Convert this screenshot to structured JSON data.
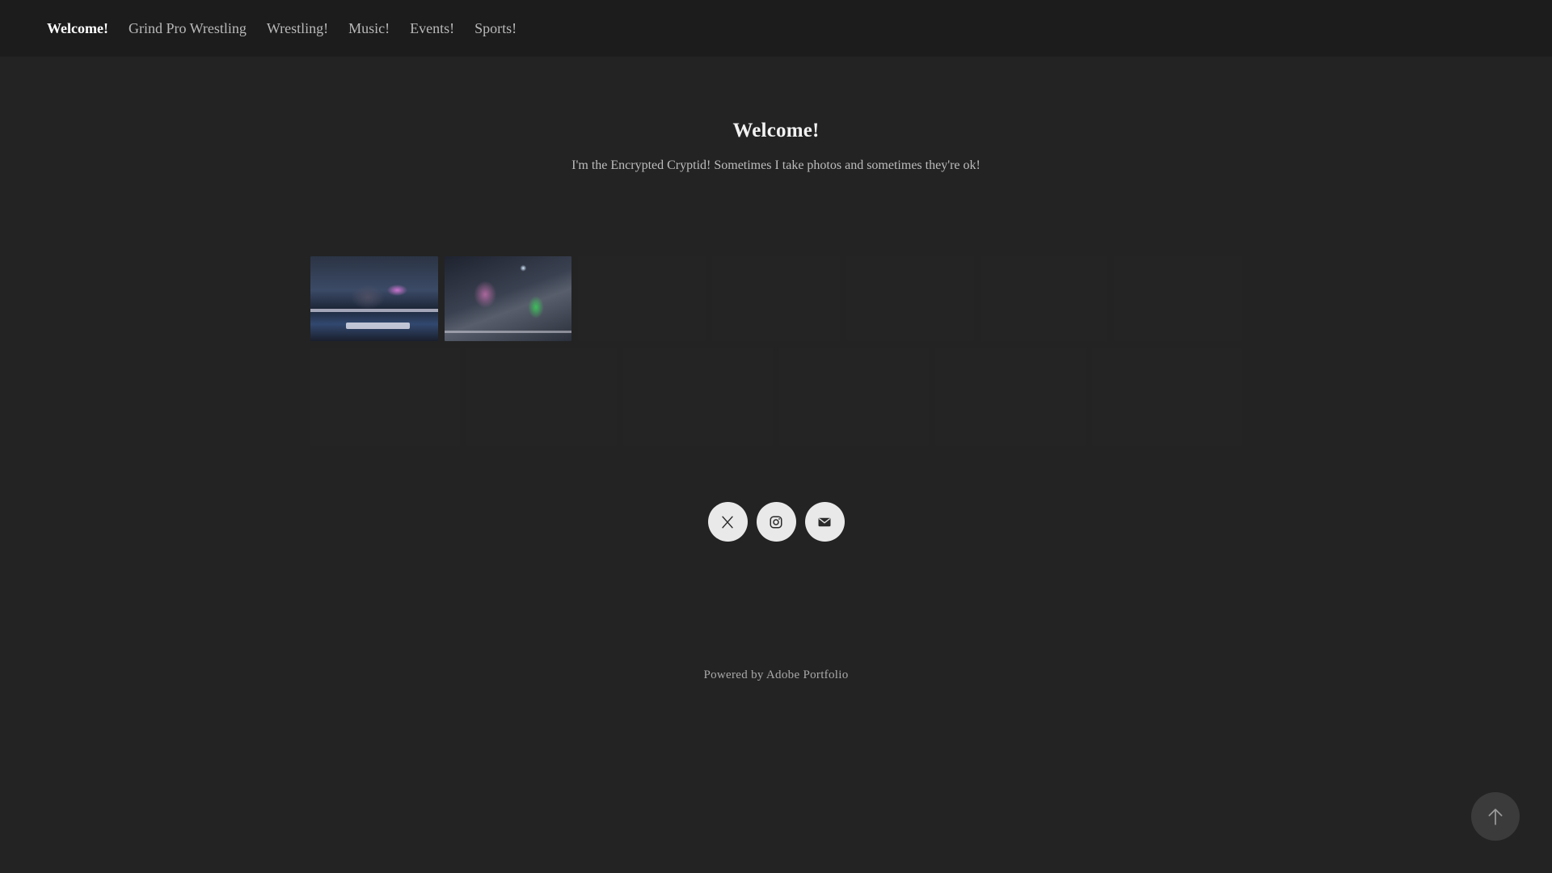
{
  "nav": {
    "items": [
      {
        "label": "Welcome!",
        "active": true
      },
      {
        "label": "Grind Pro Wrestling",
        "active": false
      },
      {
        "label": "Wrestling!",
        "active": false
      },
      {
        "label": "Music!",
        "active": false
      },
      {
        "label": "Events!",
        "active": false
      },
      {
        "label": "Sports!",
        "active": false
      }
    ]
  },
  "hero": {
    "title": "Welcome!",
    "subtitle": "I'm the Encrypted Cryptid! Sometimes I take photos and sometimes they're ok!"
  },
  "gallery": {
    "rows": [
      {
        "count": 7,
        "loaded": 2
      },
      {
        "count": 6,
        "loaded": 0
      }
    ]
  },
  "socials": {
    "icons": [
      "x-icon",
      "instagram-icon",
      "mail-icon"
    ]
  },
  "footer": {
    "text": "Powered by Adobe Portfolio"
  },
  "colors": {
    "background": "#232323",
    "nav_background": "#1c1c1c",
    "social_button": "#e9e9e9",
    "back_to_top": "#3b3b3b"
  }
}
